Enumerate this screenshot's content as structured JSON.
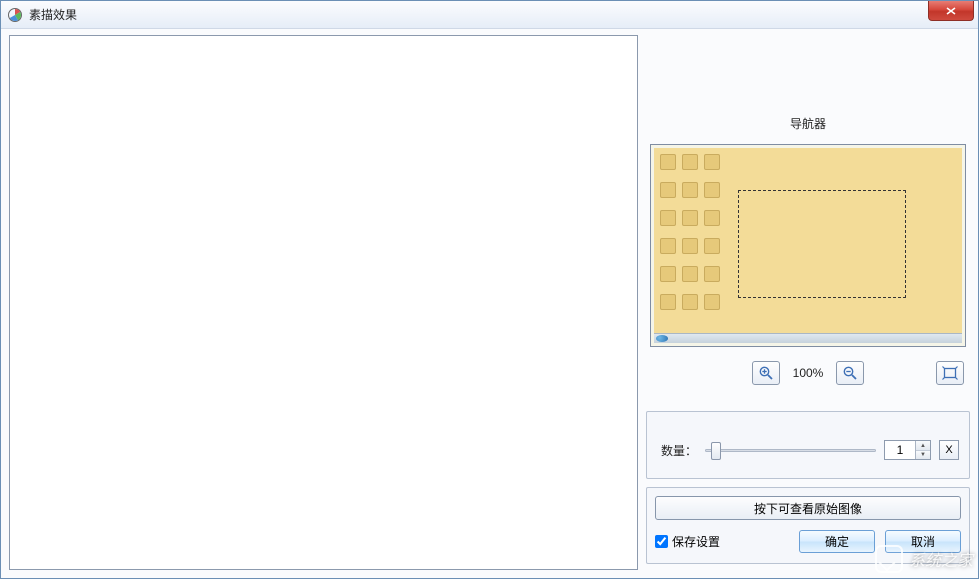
{
  "window": {
    "title": "素描效果"
  },
  "navigator": {
    "title": "导航器"
  },
  "zoom": {
    "level": "100%"
  },
  "params": {
    "amount_label": "数量：",
    "amount_value": "1",
    "reset_label": "X"
  },
  "bottom": {
    "view_original": "按下可查看原始图像",
    "save_settings": "保存设置",
    "ok": "确定",
    "cancel": "取消"
  },
  "watermark": {
    "text": "系统之家"
  }
}
